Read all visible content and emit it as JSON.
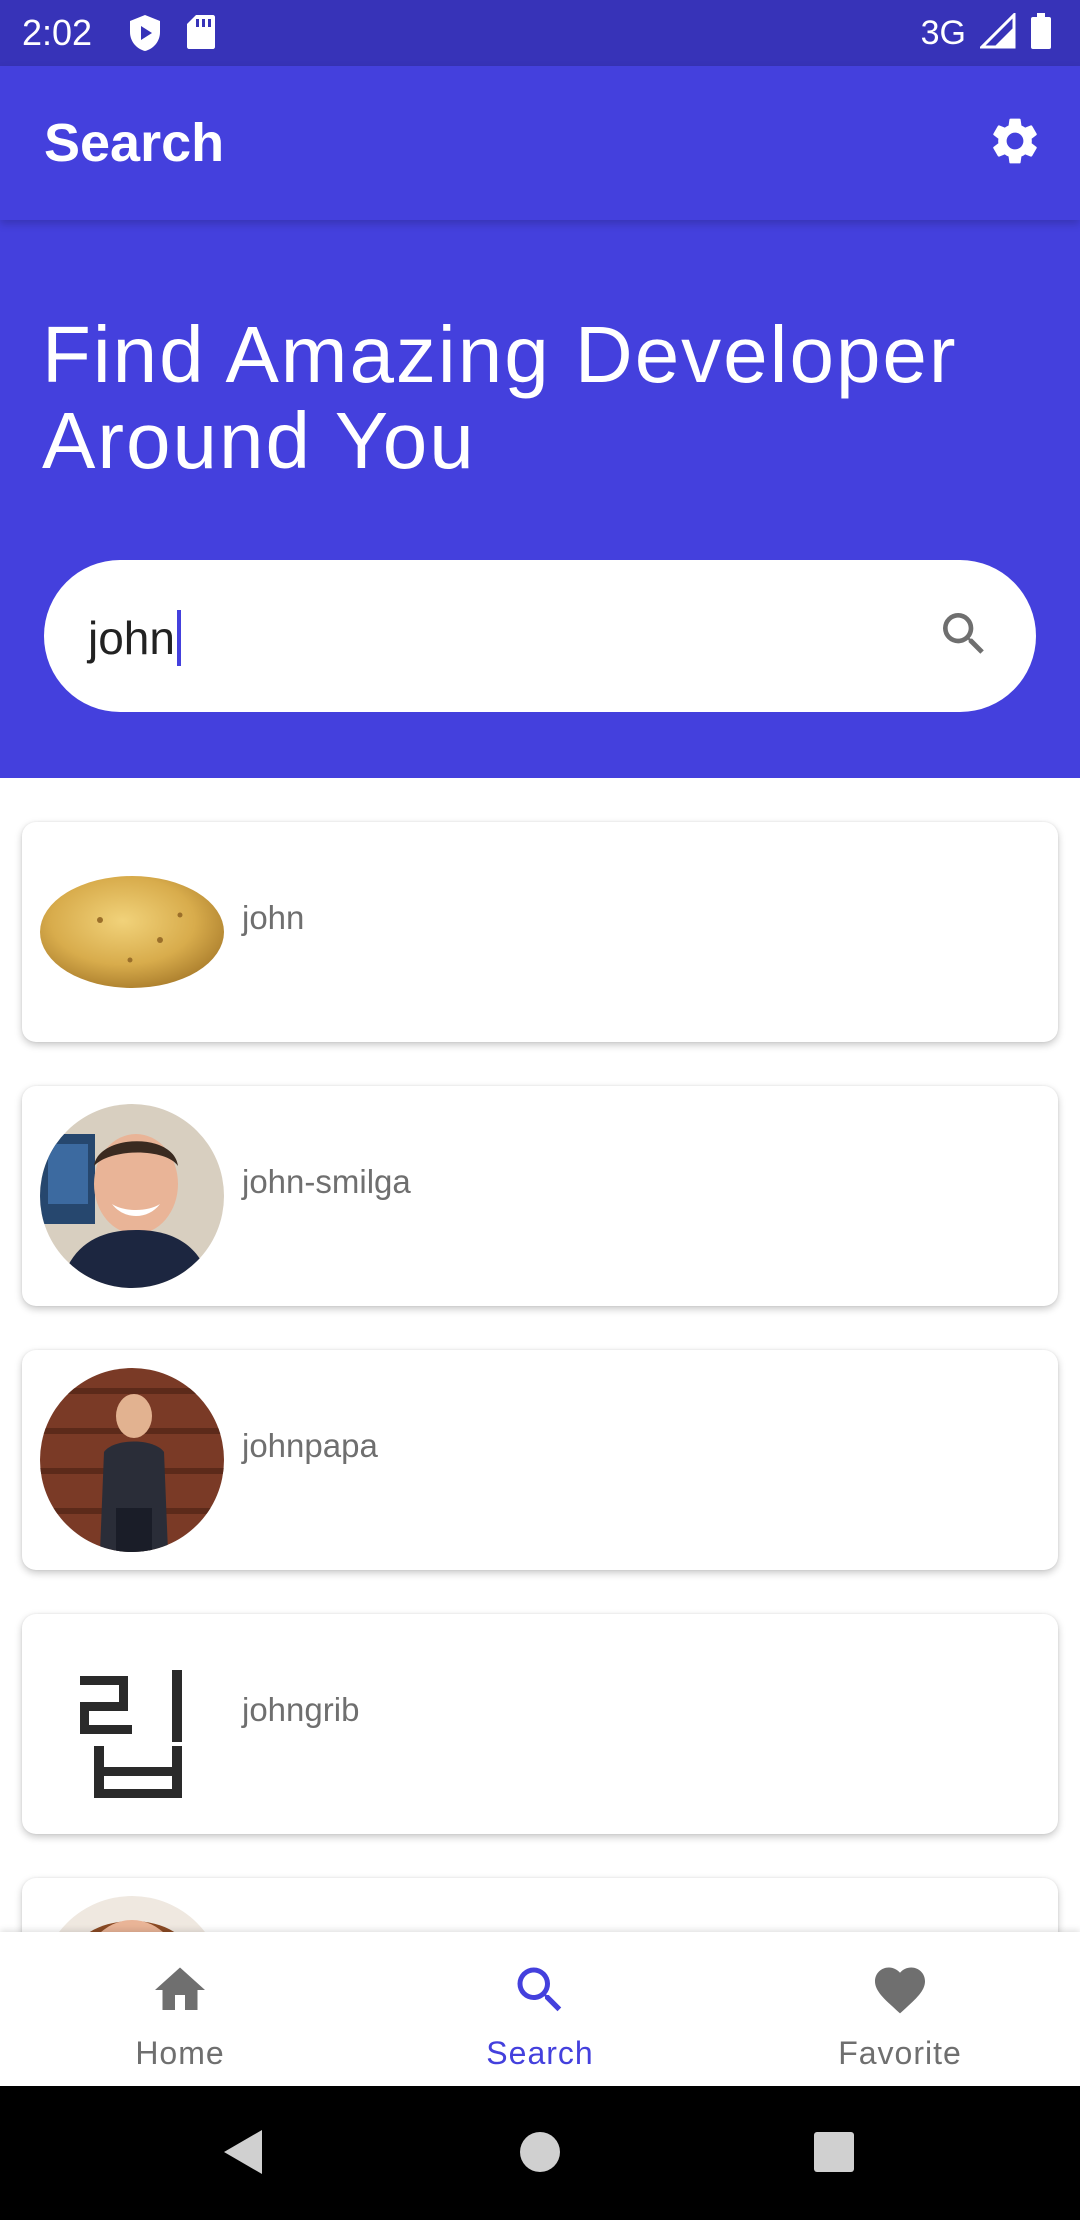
{
  "status_bar": {
    "time": "2:02",
    "network": "3G",
    "icons": [
      "play-protect-icon",
      "sd-card-icon",
      "signal-icon",
      "battery-icon"
    ]
  },
  "app_bar": {
    "title": "Search",
    "settings_icon": "gear-icon"
  },
  "hero": {
    "title": "Find Amazing Developer Around You"
  },
  "search": {
    "value": "john",
    "icon": "search-icon"
  },
  "results": [
    {
      "username": "john"
    },
    {
      "username": "john-smilga"
    },
    {
      "username": "johnpapa"
    },
    {
      "username": "johngrib"
    }
  ],
  "bottom_nav": {
    "items": [
      {
        "label": "Home",
        "icon": "home-icon"
      },
      {
        "label": "Search",
        "icon": "search-icon"
      },
      {
        "label": "Favorite",
        "icon": "heart-icon"
      }
    ],
    "active": "Search"
  },
  "colors": {
    "primary": "#4440dd",
    "status_bar": "#3733b8",
    "inactive": "#6f6f6f"
  }
}
